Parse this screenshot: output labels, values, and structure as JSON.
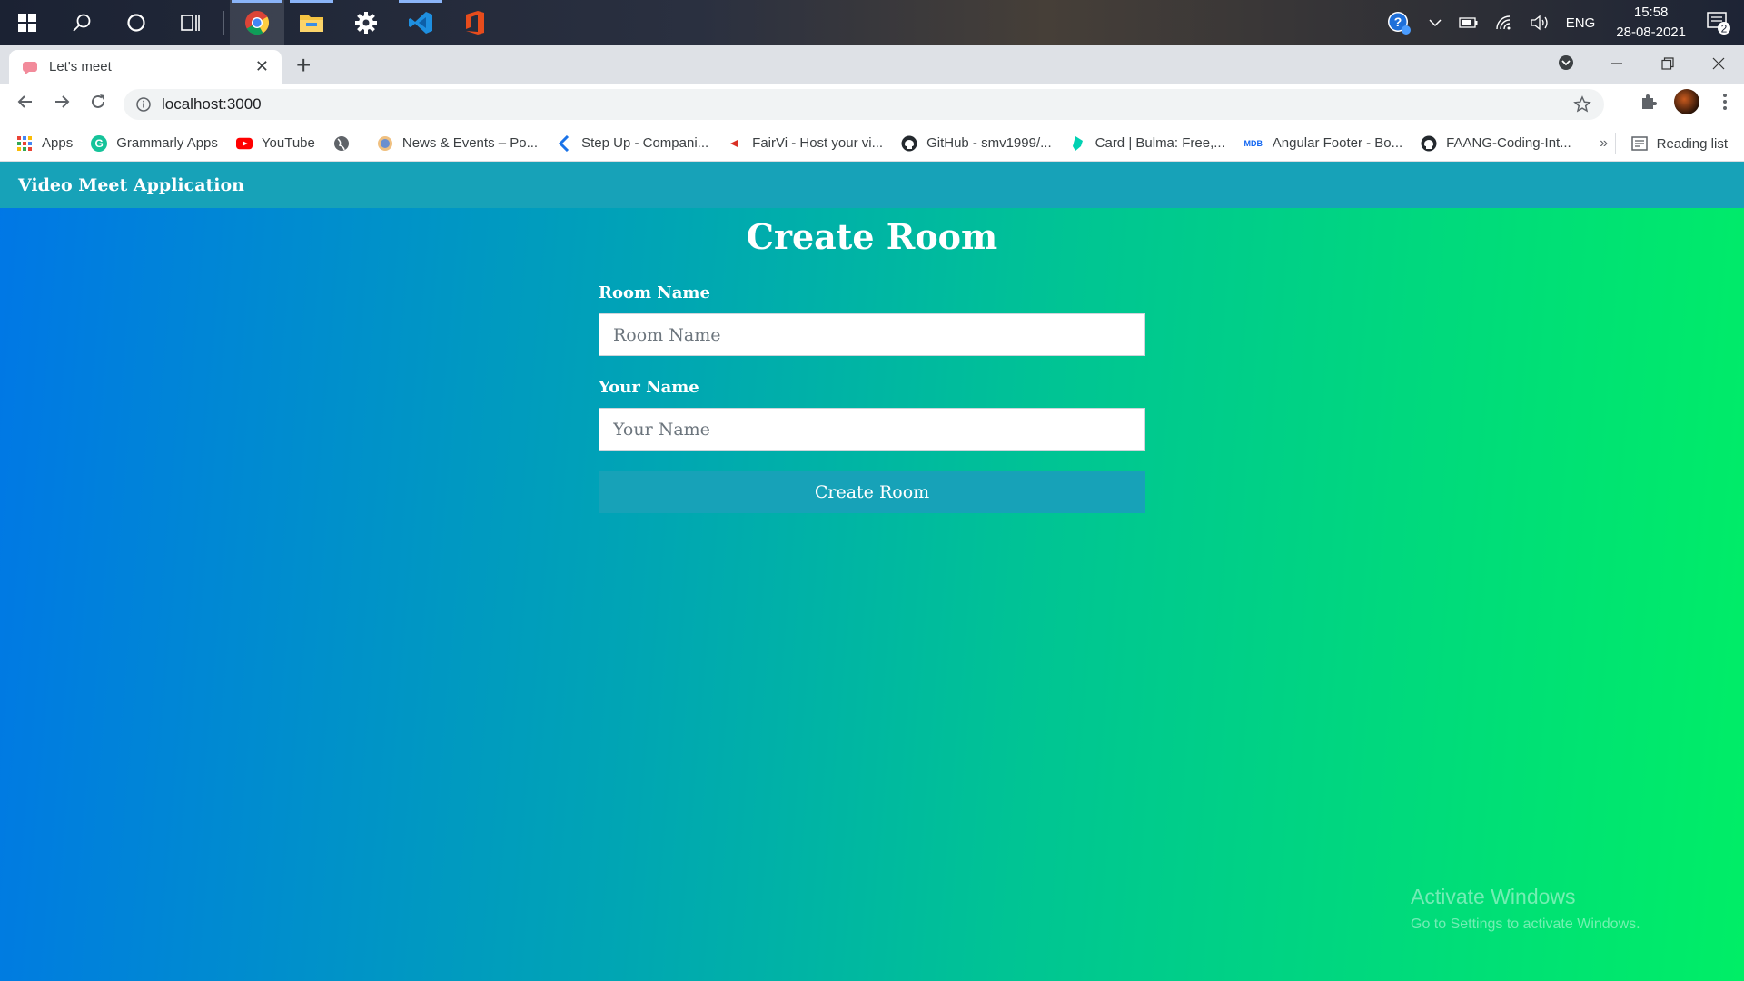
{
  "taskbar": {
    "apps": [
      "windows-start",
      "search",
      "cortana",
      "task-view",
      "chrome",
      "file-explorer",
      "settings",
      "vscode",
      "office"
    ],
    "tray": {
      "language": "ENG",
      "time": "15:58",
      "date": "28-08-2021",
      "notification_count": "2"
    }
  },
  "browser": {
    "tab_title": "Let's meet",
    "url": "localhost:3000",
    "bookmarks": [
      {
        "label": "Apps",
        "icon": "apps-grid-icon"
      },
      {
        "label": "Grammarly Apps",
        "icon": "grammarly-icon"
      },
      {
        "label": "YouTube",
        "icon": "youtube-icon"
      },
      {
        "label": "",
        "icon": "globe-icon"
      },
      {
        "label": "News & Events – Po...",
        "icon": "news-icon"
      },
      {
        "label": "Step Up - Compani...",
        "icon": "stepup-icon"
      },
      {
        "label": "FairVi - Host your vi...",
        "icon": "fairvi-icon"
      },
      {
        "label": "GitHub - smv1999/...",
        "icon": "github-icon"
      },
      {
        "label": "Card | Bulma: Free,...",
        "icon": "bulma-icon"
      },
      {
        "label": "Angular Footer - Bo...",
        "icon": "mdb-icon"
      },
      {
        "label": "FAANG-Coding-Int...",
        "icon": "github-icon"
      }
    ],
    "bookmarks_more": "»",
    "reading_list": "Reading list"
  },
  "page": {
    "navbar_brand": "Video Meet Application",
    "title": "Create Room",
    "room_name_label": "Room Name",
    "room_name_placeholder": "Room Name",
    "your_name_label": "Your Name",
    "your_name_placeholder": "Your Name",
    "submit_label": "Create Room"
  },
  "watermark": {
    "line1": "Activate Windows",
    "line2": "Go to Settings to activate Windows."
  },
  "colors": {
    "navbar": "#17a2b8",
    "gradient_start": "#0077e6",
    "gradient_end": "#00ee66"
  }
}
